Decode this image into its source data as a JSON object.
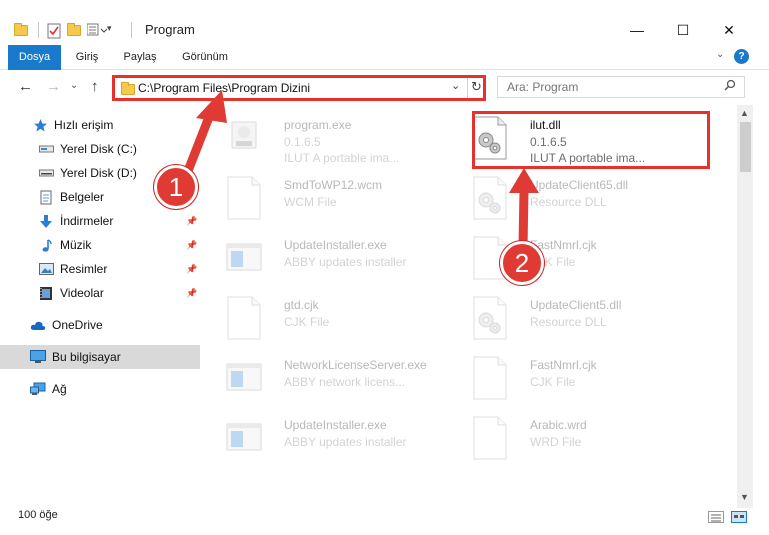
{
  "window": {
    "title": "Program",
    "minimize": "—",
    "maximize": "☐",
    "close": "✕"
  },
  "ribbon": {
    "tabs": [
      "Dosya",
      "Giriş",
      "Paylaş",
      "Görünüm"
    ],
    "expand": "⌄",
    "help": "?"
  },
  "navigation": {
    "back": "←",
    "forward": "→",
    "up_dropdown": "⌄",
    "up": "↑",
    "address": "C:\\Program Files\\Program Dizini",
    "address_dropdown": "⌄",
    "refresh": "↻",
    "search_placeholder": "Ara: Program"
  },
  "sidebar": {
    "items": [
      {
        "label": "Hızlı erişim",
        "icon": "star-icon"
      },
      {
        "label": "Yerel Disk (C:)",
        "icon": "drive-icon"
      },
      {
        "label": "Yerel Disk (D:)",
        "icon": "drive-icon"
      },
      {
        "label": "Belgeler",
        "icon": "documents-icon"
      },
      {
        "label": "İndirmeler",
        "icon": "download-icon"
      },
      {
        "label": "Müzik",
        "icon": "music-icon"
      },
      {
        "label": "Resimler",
        "icon": "pictures-icon"
      },
      {
        "label": "Videolar",
        "icon": "video-icon"
      },
      {
        "label": "OneDrive",
        "icon": "cloud-icon"
      },
      {
        "label": "Bu bilgisayar",
        "icon": "computer-icon"
      },
      {
        "label": "Ağ",
        "icon": "network-icon"
      }
    ],
    "pin": "📌"
  },
  "files": [
    {
      "name": "program.exe",
      "line2": "0.1.6.5",
      "line3": "ILUT A portable ima...",
      "kind": "exe"
    },
    {
      "name": "ilut.dll",
      "line2": "0.1.6.5",
      "line3": "ILUT A portable ima...",
      "kind": "dll"
    },
    {
      "name": "SmdToWP12.wcm",
      "line2": "WCM File",
      "line3": "",
      "kind": "blank"
    },
    {
      "name": "UpdateClient65.dll",
      "line2": "Resource DLL",
      "line3": "",
      "kind": "dll"
    },
    {
      "name": "UpdateInstaller.exe",
      "line2": "ABBY updates installer",
      "line3": "",
      "kind": "window"
    },
    {
      "name": "FastNmrl.cjk",
      "line2": "CJK File",
      "line3": "",
      "kind": "blank"
    },
    {
      "name": "gtd.cjk",
      "line2": "CJK File",
      "line3": "",
      "kind": "blank"
    },
    {
      "name": "UpdateClient5.dll",
      "line2": "Resource DLL",
      "line3": "",
      "kind": "dll"
    },
    {
      "name": "NetworkLicenseServer.exe",
      "line2": "ABBY network licens...",
      "line3": "",
      "kind": "window"
    },
    {
      "name": "FastNmrl.cjk",
      "line2": "CJK File",
      "line3": "",
      "kind": "blank"
    },
    {
      "name": "UpdateInstaller.exe",
      "line2": "ABBY updates installer",
      "line3": "",
      "kind": "window"
    },
    {
      "name": "Arabic.wrd",
      "line2": "WRD File",
      "line3": "",
      "kind": "blank"
    }
  ],
  "status": {
    "count": "100 öğe"
  },
  "annotations": {
    "badge1": "1",
    "badge2": "2"
  },
  "colors": {
    "accent": "#1979ca",
    "highlight": "#e5322d"
  }
}
